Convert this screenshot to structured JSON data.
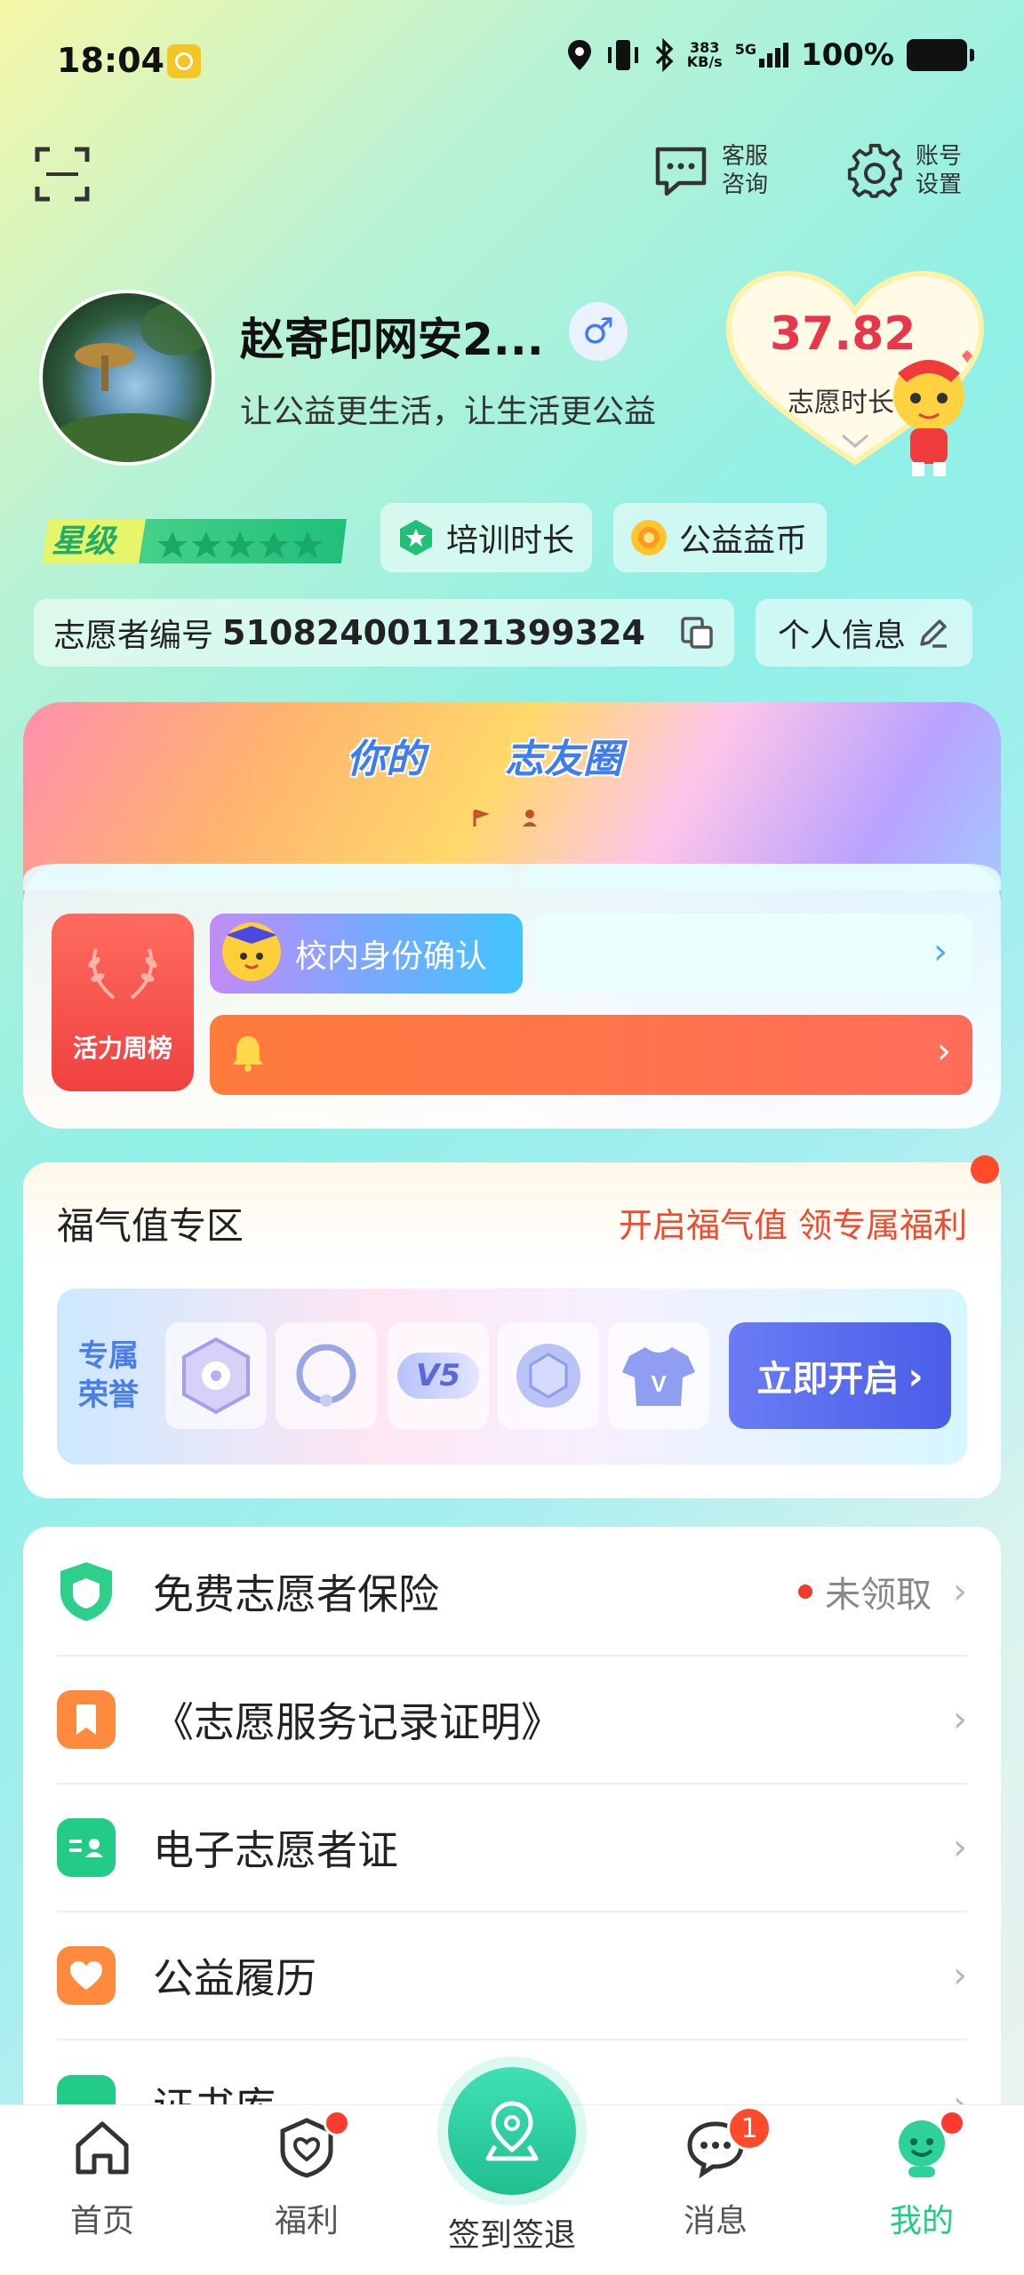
{
  "status_bar": {
    "time": "18:04",
    "net_speed_top": "383",
    "net_speed_bottom": "KB/s",
    "network": "5G",
    "battery": "100%"
  },
  "header": {
    "customer_service": [
      "客服",
      "咨询"
    ],
    "account_settings": [
      "账号",
      "设置"
    ]
  },
  "profile": {
    "name": "赵寄印网安2...",
    "motto": "让公益更生活，让生活更公益",
    "gender_symbol": "♂",
    "volunteer_hours_value": "37.82",
    "volunteer_hours_label": "志愿时长",
    "star_level_label": "星级",
    "training_hours_label": "培训时长",
    "charity_coin_label": "公益益币",
    "volunteer_id_label": "志愿者编号",
    "volunteer_id": "510824001121399324",
    "personal_info_label": "个人信息"
  },
  "circle_card": {
    "title_left": "你的",
    "title_right": "志友圈",
    "weekly_rank_label": "活力周榜",
    "campus_label": "校内身份确认"
  },
  "blessing_zone": {
    "title": "福气值专区",
    "promo": "开启福气值 领专属福利",
    "honor_label": "专属荣誉",
    "v5_label": "V5",
    "v_label": "V",
    "open_button": "立即开启"
  },
  "menu": [
    {
      "label": "免费志愿者保险",
      "status": "未领取",
      "icon": "shield-icon",
      "color": "#2ecf8b"
    },
    {
      "label": "《志愿服务记录证明》",
      "status": "",
      "icon": "bookmark-icon",
      "color": "#ff8a3d"
    },
    {
      "label": "电子志愿者证",
      "status": "",
      "icon": "id-card-icon",
      "color": "#22cc88"
    },
    {
      "label": "公益履历",
      "status": "",
      "icon": "heart-icon",
      "color": "#ff8a3d"
    },
    {
      "label": "证书库",
      "status": "",
      "icon": "certificate-icon",
      "color": "#22cc88"
    }
  ],
  "bottom_nav": {
    "home": "首页",
    "welfare": "福利",
    "checkin": "签到签退",
    "messages": "消息",
    "messages_count": "1",
    "mine": "我的"
  },
  "colors": {
    "accent_green": "#22cc88",
    "hours_red": "#e8364a",
    "promo_red": "#ef4b2f",
    "active_nav": "#22cc88"
  }
}
